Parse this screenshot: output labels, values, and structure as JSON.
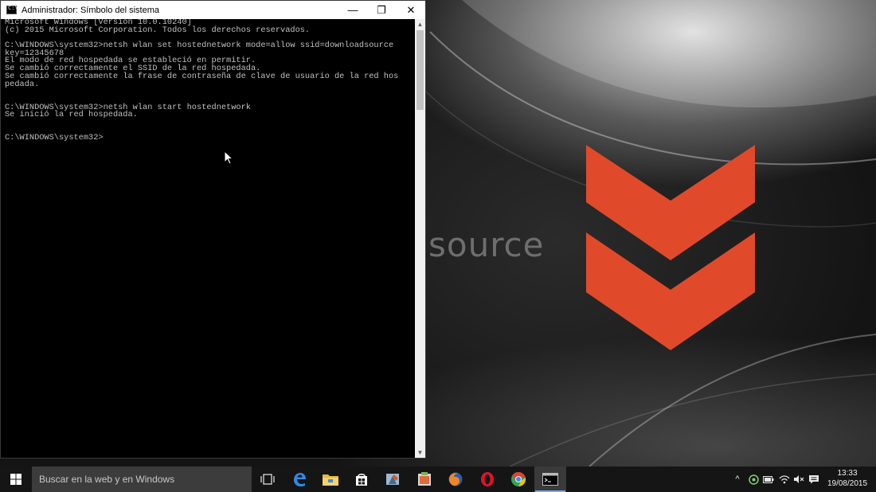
{
  "cmd_window": {
    "title": "Administrador: Símbolo del sistema",
    "title_icon_text": "C:\\",
    "controls": {
      "minimize": "—",
      "maximize": "❐",
      "close": "✕"
    },
    "lines": [
      "Microsoft Windows [Versión 10.0.10240]",
      "(c) 2015 Microsoft Corporation. Todos los derechos reservados.",
      "",
      "C:\\WINDOWS\\system32>netsh wlan set hostednetwork mode=allow ssid=downloadsource",
      "key=12345678",
      "El modo de red hospedada se estableció en permitir.",
      "Se cambió correctamente el SSID de la red hospedada.",
      "Se cambió correctamente la frase de contraseña de clave de usuario de la red hos",
      "pedada.",
      "",
      "",
      "C:\\WINDOWS\\system32>netsh wlan start hostednetwork",
      "Se inició la red hospedada.",
      "",
      "",
      "C:\\WINDOWS\\system32>"
    ]
  },
  "wallpaper": {
    "brand_text": "source",
    "logo_color": "#e04a2a"
  },
  "taskbar": {
    "search_placeholder": "Buscar en la web y en Windows",
    "pinned": [
      "task-view-icon",
      "edge-icon",
      "file-explorer-icon",
      "store-icon",
      "paint-icon",
      "app-icon",
      "firefox-icon",
      "opera-icon",
      "chrome-icon",
      "cmd-icon"
    ],
    "clock": {
      "time": "13:33",
      "date": "19/08/2015"
    }
  },
  "colors": {
    "taskbar_bg": "#151515",
    "search_bg": "#3c3c3c",
    "console_text": "#c0c0c0",
    "accent": "#7aa7d8"
  }
}
